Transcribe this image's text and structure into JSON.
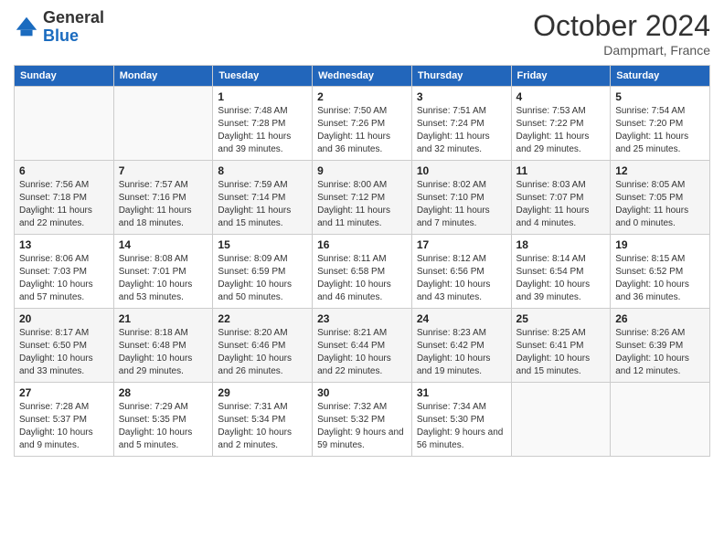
{
  "header": {
    "logo_general": "General",
    "logo_blue": "Blue",
    "month_title": "October 2024",
    "location": "Dampmart, France"
  },
  "weekdays": [
    "Sunday",
    "Monday",
    "Tuesday",
    "Wednesday",
    "Thursday",
    "Friday",
    "Saturday"
  ],
  "weeks": [
    [
      {
        "day": "",
        "info": ""
      },
      {
        "day": "",
        "info": ""
      },
      {
        "day": "1",
        "info": "Sunrise: 7:48 AM\nSunset: 7:28 PM\nDaylight: 11 hours and 39 minutes."
      },
      {
        "day": "2",
        "info": "Sunrise: 7:50 AM\nSunset: 7:26 PM\nDaylight: 11 hours and 36 minutes."
      },
      {
        "day": "3",
        "info": "Sunrise: 7:51 AM\nSunset: 7:24 PM\nDaylight: 11 hours and 32 minutes."
      },
      {
        "day": "4",
        "info": "Sunrise: 7:53 AM\nSunset: 7:22 PM\nDaylight: 11 hours and 29 minutes."
      },
      {
        "day": "5",
        "info": "Sunrise: 7:54 AM\nSunset: 7:20 PM\nDaylight: 11 hours and 25 minutes."
      }
    ],
    [
      {
        "day": "6",
        "info": "Sunrise: 7:56 AM\nSunset: 7:18 PM\nDaylight: 11 hours and 22 minutes."
      },
      {
        "day": "7",
        "info": "Sunrise: 7:57 AM\nSunset: 7:16 PM\nDaylight: 11 hours and 18 minutes."
      },
      {
        "day": "8",
        "info": "Sunrise: 7:59 AM\nSunset: 7:14 PM\nDaylight: 11 hours and 15 minutes."
      },
      {
        "day": "9",
        "info": "Sunrise: 8:00 AM\nSunset: 7:12 PM\nDaylight: 11 hours and 11 minutes."
      },
      {
        "day": "10",
        "info": "Sunrise: 8:02 AM\nSunset: 7:10 PM\nDaylight: 11 hours and 7 minutes."
      },
      {
        "day": "11",
        "info": "Sunrise: 8:03 AM\nSunset: 7:07 PM\nDaylight: 11 hours and 4 minutes."
      },
      {
        "day": "12",
        "info": "Sunrise: 8:05 AM\nSunset: 7:05 PM\nDaylight: 11 hours and 0 minutes."
      }
    ],
    [
      {
        "day": "13",
        "info": "Sunrise: 8:06 AM\nSunset: 7:03 PM\nDaylight: 10 hours and 57 minutes."
      },
      {
        "day": "14",
        "info": "Sunrise: 8:08 AM\nSunset: 7:01 PM\nDaylight: 10 hours and 53 minutes."
      },
      {
        "day": "15",
        "info": "Sunrise: 8:09 AM\nSunset: 6:59 PM\nDaylight: 10 hours and 50 minutes."
      },
      {
        "day": "16",
        "info": "Sunrise: 8:11 AM\nSunset: 6:58 PM\nDaylight: 10 hours and 46 minutes."
      },
      {
        "day": "17",
        "info": "Sunrise: 8:12 AM\nSunset: 6:56 PM\nDaylight: 10 hours and 43 minutes."
      },
      {
        "day": "18",
        "info": "Sunrise: 8:14 AM\nSunset: 6:54 PM\nDaylight: 10 hours and 39 minutes."
      },
      {
        "day": "19",
        "info": "Sunrise: 8:15 AM\nSunset: 6:52 PM\nDaylight: 10 hours and 36 minutes."
      }
    ],
    [
      {
        "day": "20",
        "info": "Sunrise: 8:17 AM\nSunset: 6:50 PM\nDaylight: 10 hours and 33 minutes."
      },
      {
        "day": "21",
        "info": "Sunrise: 8:18 AM\nSunset: 6:48 PM\nDaylight: 10 hours and 29 minutes."
      },
      {
        "day": "22",
        "info": "Sunrise: 8:20 AM\nSunset: 6:46 PM\nDaylight: 10 hours and 26 minutes."
      },
      {
        "day": "23",
        "info": "Sunrise: 8:21 AM\nSunset: 6:44 PM\nDaylight: 10 hours and 22 minutes."
      },
      {
        "day": "24",
        "info": "Sunrise: 8:23 AM\nSunset: 6:42 PM\nDaylight: 10 hours and 19 minutes."
      },
      {
        "day": "25",
        "info": "Sunrise: 8:25 AM\nSunset: 6:41 PM\nDaylight: 10 hours and 15 minutes."
      },
      {
        "day": "26",
        "info": "Sunrise: 8:26 AM\nSunset: 6:39 PM\nDaylight: 10 hours and 12 minutes."
      }
    ],
    [
      {
        "day": "27",
        "info": "Sunrise: 7:28 AM\nSunset: 5:37 PM\nDaylight: 10 hours and 9 minutes."
      },
      {
        "day": "28",
        "info": "Sunrise: 7:29 AM\nSunset: 5:35 PM\nDaylight: 10 hours and 5 minutes."
      },
      {
        "day": "29",
        "info": "Sunrise: 7:31 AM\nSunset: 5:34 PM\nDaylight: 10 hours and 2 minutes."
      },
      {
        "day": "30",
        "info": "Sunrise: 7:32 AM\nSunset: 5:32 PM\nDaylight: 9 hours and 59 minutes."
      },
      {
        "day": "31",
        "info": "Sunrise: 7:34 AM\nSunset: 5:30 PM\nDaylight: 9 hours and 56 minutes."
      },
      {
        "day": "",
        "info": ""
      },
      {
        "day": "",
        "info": ""
      }
    ]
  ]
}
